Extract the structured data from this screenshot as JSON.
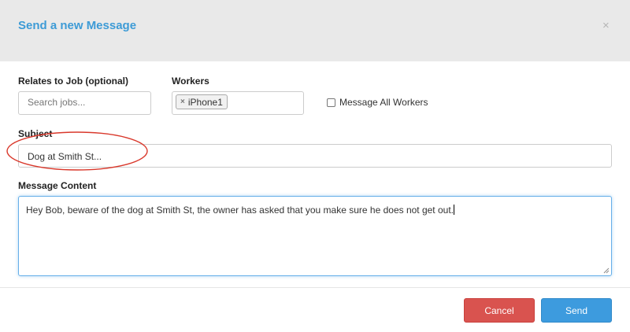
{
  "dialog": {
    "title": "Send a new Message",
    "close_glyph": "×"
  },
  "job": {
    "label": "Relates to Job (optional)",
    "placeholder": "Search jobs..."
  },
  "workers": {
    "label": "Workers",
    "tokens": [
      {
        "label": "iPhone1",
        "remove_glyph": "×"
      }
    ],
    "message_all_label": "Message All Workers",
    "message_all_checked": false
  },
  "subject": {
    "label": "Subject",
    "value": "Dog at Smith St..."
  },
  "message": {
    "label": "Message Content",
    "value": "Hey Bob, beware of the dog at Smith St, the owner has asked that you make sure he does not get out."
  },
  "buttons": {
    "cancel": "Cancel",
    "send": "Send"
  },
  "colors": {
    "title": "#3d9bd6",
    "header_bg": "#e9e9e9",
    "cancel_bg": "#d9534f",
    "send_bg": "#3d9bde",
    "focus_border": "#66afe9",
    "annotation": "#d9382b"
  },
  "icons": {
    "close": "close-icon",
    "token_remove": "remove-token-icon",
    "resize": "resize-handle-icon"
  }
}
